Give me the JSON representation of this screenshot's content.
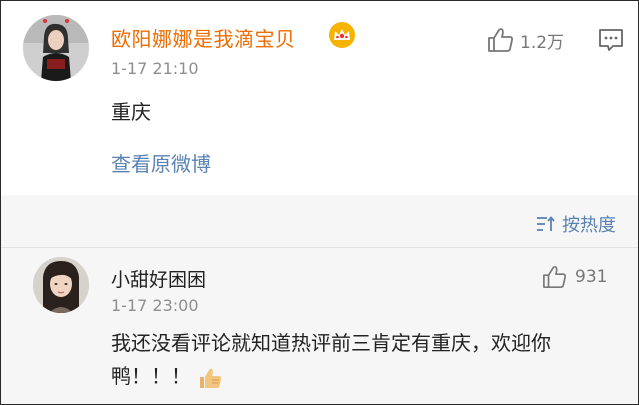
{
  "main_comment": {
    "username": "欧阳娜娜是我滴宝贝",
    "time": "1-17 21:10",
    "text": "重庆",
    "view_original": "查看原微博",
    "likes": "1.2万",
    "badge_icon": "crown-icon",
    "like_icon": "thumb-up-icon",
    "reply_icon": "comment-icon"
  },
  "sort": {
    "label": "按热度",
    "icon": "sort-icon"
  },
  "sub_comment": {
    "username": "小甜好困困",
    "time": "1-17 23:00",
    "text": "我还没看评论就知道热评前三肯定有重庆，欢迎你鸭！！！",
    "likes": "931",
    "emoji": "thumbs-up-emoji"
  },
  "colors": {
    "username_vip": "#ef6c00",
    "link": "#5a82b3",
    "meta": "#8e8e8e",
    "sub_background": "#f6f6f6"
  }
}
